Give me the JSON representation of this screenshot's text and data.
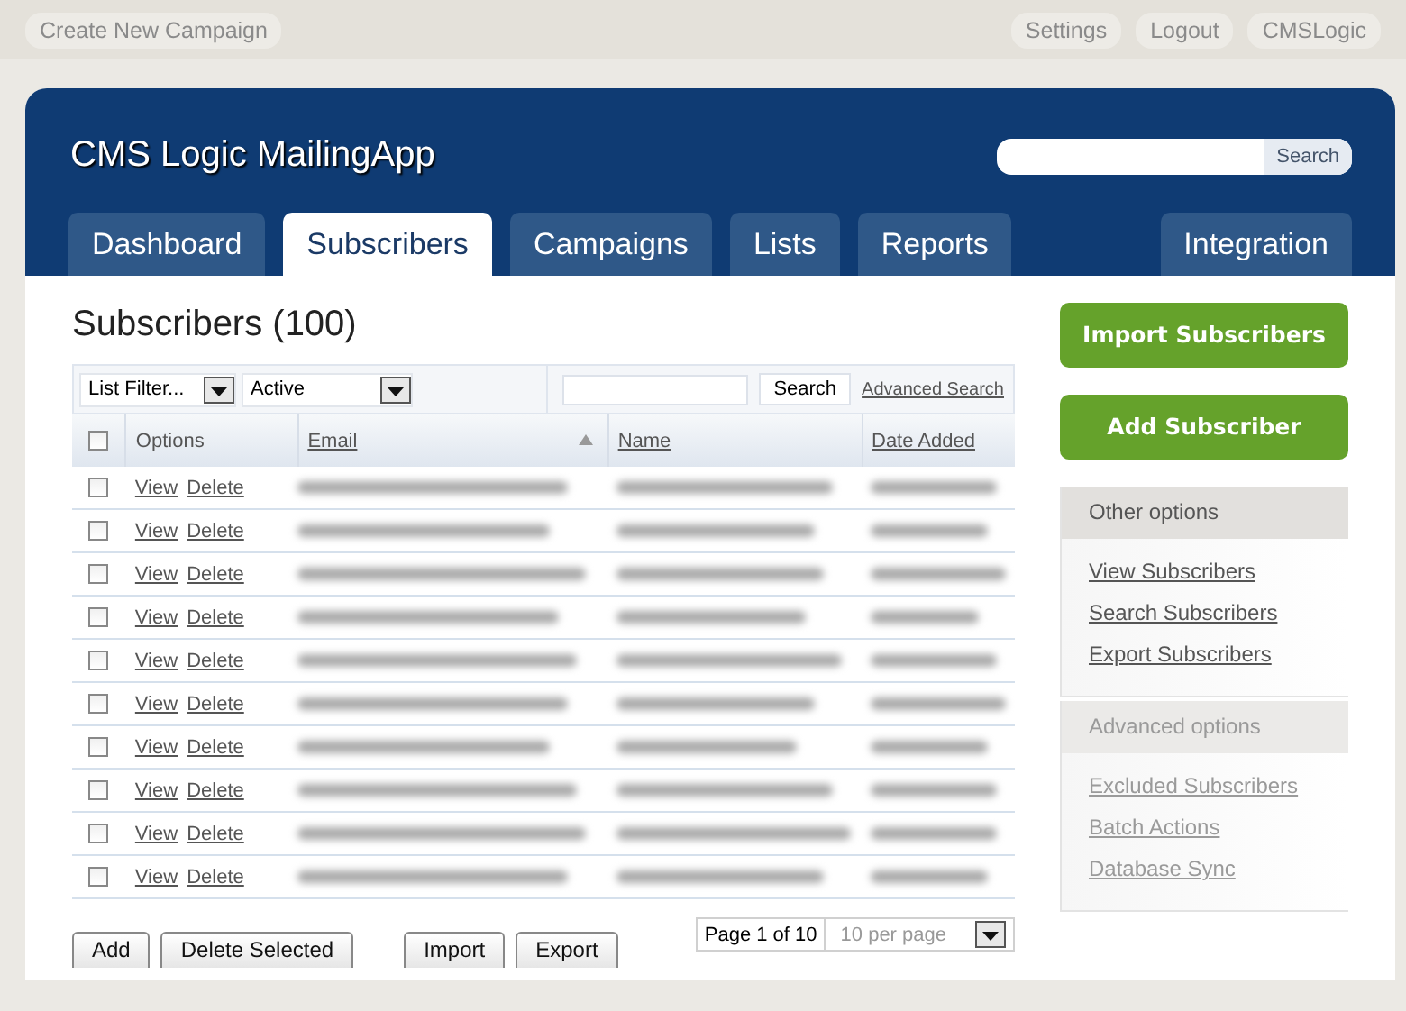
{
  "top_bar": {
    "left": [
      "Create New Campaign"
    ],
    "right": [
      "Settings",
      "Logout",
      "CMSLogic"
    ]
  },
  "header": {
    "title": "CMS Logic MailingApp",
    "search_button": "Search"
  },
  "tabs": [
    {
      "label": "Dashboard",
      "selected": false
    },
    {
      "label": "Subscribers",
      "selected": true
    },
    {
      "label": "Campaigns",
      "selected": false
    },
    {
      "label": "Lists",
      "selected": false
    },
    {
      "label": "Reports",
      "selected": false
    },
    {
      "label": "Integration",
      "selected": false
    }
  ],
  "page_title": "Subscribers (100)",
  "filters": {
    "list_filter": "List Filter...",
    "status": "Active",
    "search_button": "Search",
    "advanced_search": "Advanced Search"
  },
  "table": {
    "select_all_checked": false,
    "columns": [
      {
        "label": "Options",
        "link": false,
        "sorted": false
      },
      {
        "label": "Email",
        "link": true,
        "sorted": true
      },
      {
        "label": "Name",
        "link": true,
        "sorted": false
      },
      {
        "label": "Date Added",
        "link": true,
        "sorted": false
      }
    ],
    "rows": [
      {
        "checked": false,
        "actions": [
          "View",
          "Delete"
        ]
      },
      {
        "checked": false,
        "actions": [
          "View",
          "Delete"
        ]
      },
      {
        "checked": false,
        "actions": [
          "View",
          "Delete"
        ]
      },
      {
        "checked": false,
        "actions": [
          "View",
          "Delete"
        ]
      },
      {
        "checked": false,
        "actions": [
          "View",
          "Delete"
        ]
      },
      {
        "checked": false,
        "actions": [
          "View",
          "Delete"
        ]
      },
      {
        "checked": false,
        "actions": [
          "View",
          "Delete"
        ]
      },
      {
        "checked": false,
        "actions": [
          "View",
          "Delete"
        ]
      },
      {
        "checked": false,
        "actions": [
          "View",
          "Delete"
        ]
      },
      {
        "checked": false,
        "actions": [
          "View",
          "Delete"
        ]
      }
    ]
  },
  "bottom_buttons": {
    "left": [
      "Add",
      "Delete Selected"
    ],
    "right": [
      "Import",
      "Export"
    ]
  },
  "pager": {
    "page": "Page 1 of 10",
    "per_page": "10 per page"
  },
  "sidebar": {
    "buttons": [
      "Import Subscribers",
      "Add Subscriber"
    ],
    "sections": [
      {
        "title": "Other options",
        "disabled": false,
        "links": [
          "View Subscribers",
          "Search Subscribers",
          "Export Subscribers"
        ]
      },
      {
        "title": "Advanced options",
        "disabled": true,
        "links": [
          "Excluded Subscribers",
          "Batch Actions",
          "Database Sync"
        ]
      }
    ]
  }
}
